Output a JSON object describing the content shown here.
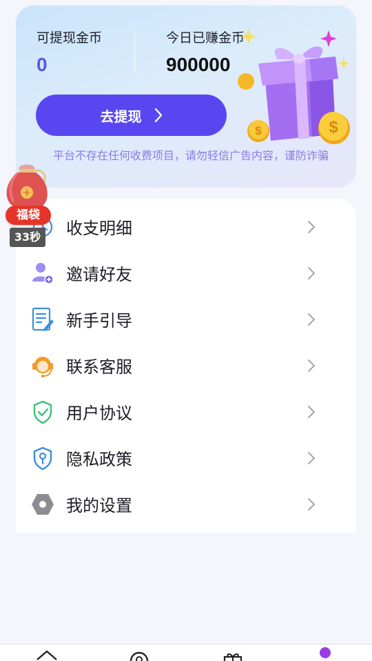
{
  "wallet": {
    "withdrawable_label": "可提现金币",
    "withdrawable_value": "0",
    "today_label": "今日已赚金币",
    "today_value": "900000",
    "withdraw_button": "去提现",
    "notice": "平台不存在任何收费项目，请勿轻信广告内容，谨防诈骗"
  },
  "lucky_bag": {
    "label": "福袋",
    "timer": "33秒"
  },
  "menu": {
    "items": [
      {
        "label": "收支明细",
        "icon": "history-icon"
      },
      {
        "label": "邀请好友",
        "icon": "invite-user-icon"
      },
      {
        "label": "新手引导",
        "icon": "guide-doc-icon"
      },
      {
        "label": "联系客服",
        "icon": "customer-service-icon"
      },
      {
        "label": "用户协议",
        "icon": "shield-check-icon"
      },
      {
        "label": "隐私政策",
        "icon": "privacy-shield-icon"
      },
      {
        "label": "我的设置",
        "icon": "settings-icon"
      }
    ]
  },
  "bottom_nav": {
    "items": [
      {
        "icon": "home-icon"
      },
      {
        "icon": "discover-icon"
      },
      {
        "icon": "gift-icon"
      },
      {
        "icon": "profile-icon",
        "active": true
      }
    ]
  },
  "colors": {
    "accent": "#5a46f1",
    "coin_value": "#5b57e6",
    "notice": "#8a7be8",
    "badge_red": "#e53529",
    "profile_active": "#9b3be8"
  }
}
